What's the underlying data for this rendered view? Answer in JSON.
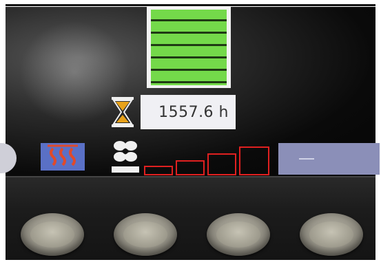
{
  "hour_meter": {
    "value_text": "1557.6 h"
  },
  "fuel_gauge": {
    "level_fraction": 1.0,
    "segments": 6
  },
  "fan_speed": {
    "levels": 4
  },
  "colors": {
    "fuel_fill": "#74d94a",
    "fan_outline": "#e02020",
    "heater_button": "#5a70c6",
    "right_button": "#8b8fb8"
  },
  "icons": {
    "hourglass": "hourglass-icon",
    "fan": "fan-icon",
    "heater": "heater-waves-icon"
  },
  "soft_keys": [
    "softkey-1",
    "softkey-2",
    "softkey-3",
    "softkey-4"
  ]
}
